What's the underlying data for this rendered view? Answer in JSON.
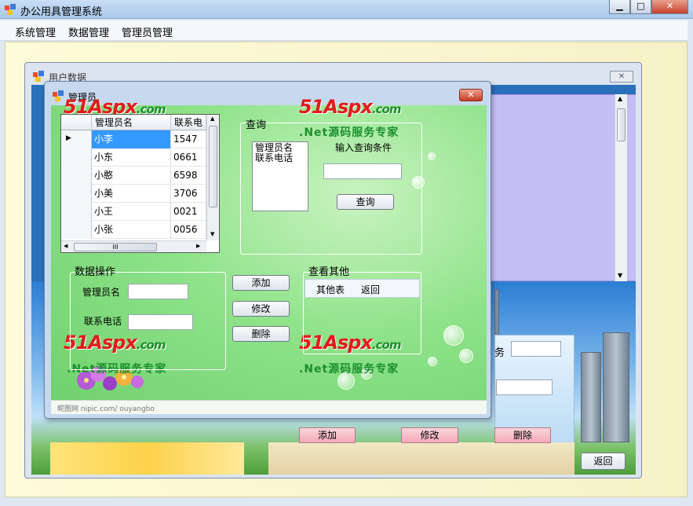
{
  "app": {
    "title": "办公用具管理系统",
    "window_controls": {
      "minimize": "▁",
      "maximize": "□",
      "close": "✕"
    }
  },
  "menu": {
    "items": [
      "系统管理",
      "数据管理",
      "管理员管理"
    ]
  },
  "user_window": {
    "title": "用户数据",
    "close": "✕",
    "buttons": {
      "add": "添加",
      "edit": "修改",
      "delete": "删除",
      "back": "返回"
    },
    "partial_label": "务"
  },
  "admin_window": {
    "title": "管理员",
    "close": "✕",
    "grid": {
      "columns": [
        "管理员名",
        "联系电"
      ],
      "rows": [
        {
          "name": "小李",
          "phone": "1547",
          "selected": true
        },
        {
          "name": "小东",
          "phone": "0661",
          "selected": false
        },
        {
          "name": "小憨",
          "phone": "6598",
          "selected": false
        },
        {
          "name": "小美",
          "phone": "3706",
          "selected": false
        },
        {
          "name": "小王",
          "phone": "0021",
          "selected": false
        },
        {
          "name": "小张",
          "phone": "0056",
          "selected": false
        }
      ],
      "hscroll_grip": "III"
    },
    "query": {
      "group_title": "查询",
      "fields": [
        "管理员名",
        "联系电话"
      ],
      "prompt": "输入查询条件",
      "input_value": "",
      "button": "查询"
    },
    "data_ops": {
      "group_title": "数据操作",
      "name_label": "管理员名",
      "name_value": "",
      "phone_label": "联系电话",
      "phone_value": "",
      "add": "添加",
      "edit": "修改",
      "delete": "删除"
    },
    "others": {
      "group_title": "查看其他",
      "items": [
        "其他表",
        "返回"
      ]
    },
    "watermark": {
      "logo": "51Aspx",
      "domain": ".com",
      "slogan": ".Net源码服务专家"
    },
    "footer_text": "昵图网 nipic.com/ ouyangbo"
  },
  "colors": {
    "title_bar": "#b5d1ec",
    "selection": "#3399ff",
    "green_background": "#8fe38a",
    "watermark_red": "#e21b1b",
    "watermark_green": "#1b8f2e",
    "lavender_panel": "#c5bdf5",
    "pink_button": "#f4a9b8"
  }
}
